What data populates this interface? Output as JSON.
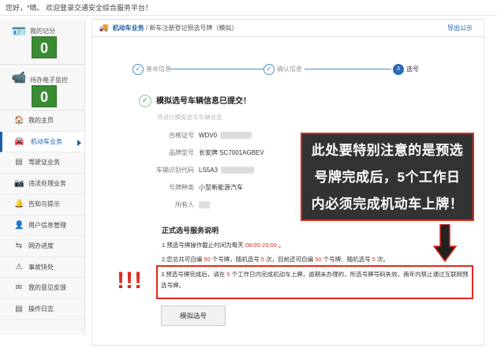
{
  "topbar": {
    "greeting": "您好，*晴。 欢迎登录交通安全综合服务平台！"
  },
  "sidebar": {
    "score": {
      "label": "我的记分",
      "value": "0"
    },
    "violation": {
      "label": "待办电子监控",
      "value": "0"
    },
    "items": [
      {
        "label": "我的主页",
        "icon": "home-icon",
        "glyph": "🏠"
      },
      {
        "label": "机动车业务",
        "icon": "car-icon",
        "glyph": "🚘"
      },
      {
        "label": "驾驶证业务",
        "icon": "license-icon",
        "glyph": "▤"
      },
      {
        "label": "违法处理业务",
        "icon": "camera-icon",
        "glyph": "📷"
      },
      {
        "label": "告知与提示",
        "icon": "bell-icon",
        "glyph": "🔔"
      },
      {
        "label": "用户信息管理",
        "icon": "user-icon",
        "glyph": "👤"
      },
      {
        "label": "网办进度",
        "icon": "progress-icon",
        "glyph": "⇆"
      },
      {
        "label": "事故快处",
        "icon": "accident-icon",
        "glyph": "⚠"
      },
      {
        "label": "我的意见反馈",
        "icon": "feedback-icon",
        "glyph": "✉"
      },
      {
        "label": "操作日志",
        "icon": "log-icon",
        "glyph": "▤"
      }
    ]
  },
  "breadcrumb": {
    "section": "机动车业务",
    "page": "/ 新车注册登记预选号牌（模拟）",
    "guide": "导出公示"
  },
  "steps": [
    {
      "label": "基本信息",
      "mark": "✓"
    },
    {
      "label": "确认信息",
      "mark": "✓"
    },
    {
      "label": "选号",
      "mark": "3"
    }
  ],
  "submitted": {
    "title": "模拟选号车辆信息已提交！",
    "hint": "将进行模拟选号车辆信息"
  },
  "vehicle": [
    {
      "key": "合格证号",
      "value": "WDV0"
    },
    {
      "key": "品牌型号",
      "value": "长安牌 SC7001AGBEV"
    },
    {
      "key": "车辆识别代码",
      "value": "LS5A3"
    },
    {
      "key": "号牌种类",
      "value": "小型新能源汽车"
    },
    {
      "key": "所有人",
      "value": ""
    }
  ],
  "service": {
    "title": "正式选号服务说明",
    "line1_a": "1.预选号牌操作截止时间为每天 ",
    "line1_b": "08:00-23:00",
    "line1_c": " 。",
    "line2_a": "2.您总共可自编 ",
    "line2_b": "50",
    "line2_c": " 个号牌，随机选号 ",
    "line2_d": "5",
    "line2_e": " 次，目前还可自编 ",
    "line2_f": "50",
    "line2_g": " 个号牌、随机选号 ",
    "line2_h": "5",
    "line2_i": " 次。",
    "line3_a": "3.预选号牌完成后，请在 ",
    "line3_b": "5",
    "line3_c": " 个工作日内完成机动车上牌，逾期未办理的，所选号牌号码失效，两年内禁止通过互联网预选号牌。"
  },
  "button": {
    "label": "模拟选号"
  },
  "annotation": {
    "callout_l1": "此处要特别注意的是预选",
    "callout_l2": "号牌完成后，5个工作日",
    "callout_l3": "内必须完成机动车上牌！",
    "bang": "!!!"
  },
  "colors": {
    "accent": "#1a5fa8",
    "green": "#3a8b34",
    "red": "#e0281e"
  }
}
